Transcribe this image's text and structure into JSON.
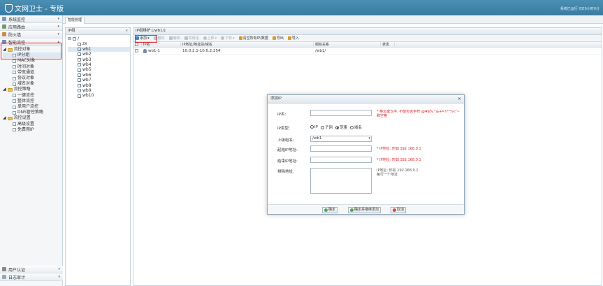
{
  "app": {
    "title": "文网卫士 - 专版",
    "top_right": "系统已运行 0天0小时0分"
  },
  "tab": {
    "label": "智能管理"
  },
  "sidebar": {
    "sections": [
      {
        "label": "系统监控"
      },
      {
        "label": "应用路由"
      },
      {
        "label": "防火墙"
      },
      {
        "label": "智能流控"
      }
    ],
    "tree": [
      {
        "label": "流控对象",
        "level": 1,
        "folder": true
      },
      {
        "label": "IP分组",
        "level": 2,
        "selected": true
      },
      {
        "label": "MAC对象",
        "level": 2
      },
      {
        "label": "时间对象",
        "level": 2
      },
      {
        "label": "带宽通道",
        "level": 2
      },
      {
        "label": "协议对象",
        "level": 2
      },
      {
        "label": "域名对象",
        "level": 2
      },
      {
        "label": "流控策略",
        "level": 1,
        "folder": true
      },
      {
        "label": "一键流控",
        "level": 2
      },
      {
        "label": "整体流控",
        "level": 2
      },
      {
        "label": "单用户流控",
        "level": 2
      },
      {
        "label": "DNS管控策略",
        "level": 2
      },
      {
        "label": "流控设置",
        "level": 1,
        "folder": true
      },
      {
        "label": "高级设置",
        "level": 2
      },
      {
        "label": "免费用IP",
        "level": 2
      }
    ],
    "bottom": [
      {
        "label": "用户认证"
      },
      {
        "label": "日志审计"
      }
    ]
  },
  "ip_panel": {
    "header": "IP组",
    "root": "/",
    "children": [
      "zx",
      "wb1",
      "wb2",
      "wb3",
      "wb4",
      "wb5",
      "wb6",
      "wb7",
      "wb8",
      "wb9",
      "wb10"
    ]
  },
  "main": {
    "breadcrumb": "IP组维护 [/wb1/]",
    "toolbar": [
      {
        "label": "添加",
        "enabled": true,
        "color": "#4a86c5"
      },
      {
        "label": "删除",
        "enabled": false,
        "color": "#b9c3cc"
      },
      {
        "label": "编辑",
        "enabled": false,
        "color": "#b9c3cc"
      },
      {
        "label": "高级组",
        "enabled": false,
        "color": "#b9c3cc"
      },
      {
        "label": "上移",
        "enabled": false,
        "color": "#b9c3cc"
      },
      {
        "label": "下移",
        "enabled": false,
        "color": "#b9c3cc"
      },
      {
        "label": "清空所有IP/数据",
        "enabled": true,
        "color": "#d99a2b"
      },
      {
        "label": "导出",
        "enabled": true,
        "color": "#d99a2b"
      },
      {
        "label": "导入",
        "enabled": true,
        "color": "#d99a2b"
      }
    ],
    "columns": [
      "IP名",
      "IP地址/地址段/域名",
      "组织关系",
      "状态"
    ],
    "rows": [
      {
        "name": "wb1-1",
        "address": "10.0.2.1-10.0.2.254",
        "group": "/wb1/",
        "status": ""
      }
    ]
  },
  "dialog": {
    "title": "添加IP",
    "fields": {
      "ip_name": {
        "label": "IP名:",
        "value": "",
        "hint": "* 英文或汉字, 不能包含字符 @#$%^&+=!?'\"/\\<'~和空格"
      },
      "ip_type": {
        "label": "IP类型:",
        "options": [
          "IP",
          "子网",
          "范围",
          "域名"
        ],
        "selected": "范围"
      },
      "parent": {
        "label": "上级组名:",
        "value": "/wb1"
      },
      "start_ip": {
        "label": "起始IP地址:",
        "value": "",
        "hint": "* IP地址: 形如 192.168.0.1"
      },
      "end_ip": {
        "label": "结束IP地址:",
        "value": "",
        "hint": "* IP地址: 形如 192.168.0.1"
      },
      "exclude": {
        "label": "排除地址:",
        "value": "",
        "hint": "IP地址: 形如 192.168.0.1",
        "hint2": "每行一个地址"
      }
    },
    "buttons": {
      "ok": "确定",
      "ok_continue": "确定并继续添加",
      "cancel": "取消"
    }
  }
}
